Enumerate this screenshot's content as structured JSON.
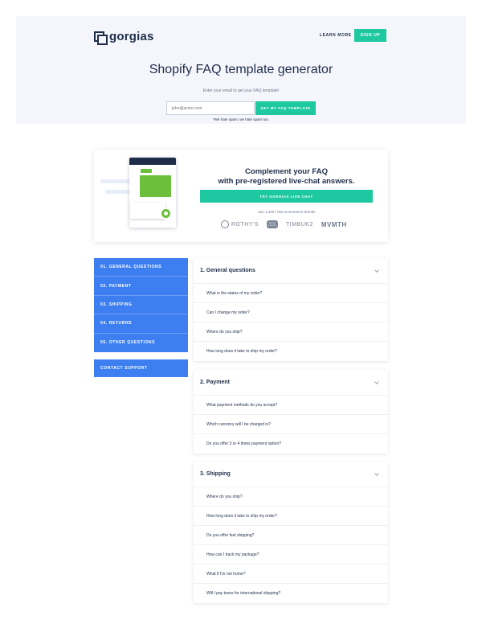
{
  "header": {
    "logo_text": "gorgias",
    "learn_more": "LEARN MORE",
    "sign_up": "SIGN UP",
    "title": "Shopify FAQ template generator",
    "subtitle": "Enter your email to get your FAQ template!",
    "email_placeholder": "john@acme.com",
    "cta": "GET MY FAQ TEMPLATE",
    "note": "*We hate spam, we hate spam too."
  },
  "promo": {
    "title_line1": "Complement your FAQ",
    "title_line2": "with pre-registered live-chat answers.",
    "button": "TRY GORGIAS LIVE CHAT",
    "caption": "Join 1,200+ fast ecommerce brands",
    "brands": [
      "ROTHY'S",
      "Skull Candy",
      "TIMBUK2",
      "MVMTH"
    ]
  },
  "nav": {
    "items": [
      "01. GENERAL QUESTIONS",
      "02. PAYMENT",
      "03. SHIPPING",
      "04. RETURNS",
      "05. OTHER QUESTIONS"
    ],
    "contact": "CONTACT SUPPORT"
  },
  "sections": [
    {
      "title": "1. General questions",
      "questions": [
        "What is the status of my order?",
        "Can I change my order?",
        "Where do you ship?",
        "How long does it take to ship my order?"
      ]
    },
    {
      "title": "2. Payment",
      "questions": [
        "What payment methods do you accept?",
        "Which currency will I be charged in?",
        "Do you offer 3 or 4 times payment option?"
      ]
    },
    {
      "title": "3. Shipping",
      "questions": [
        "Where do you ship?",
        "How long does it take to ship my order?",
        "Do you offer fast shipping?",
        "How can I track my package?",
        "What if I'm not home?",
        "Will I pay taxes for international shipping?"
      ]
    }
  ],
  "colors": {
    "accent": "#1ec8a0",
    "nav": "#3d7ff0",
    "text": "#1f2d4a"
  }
}
